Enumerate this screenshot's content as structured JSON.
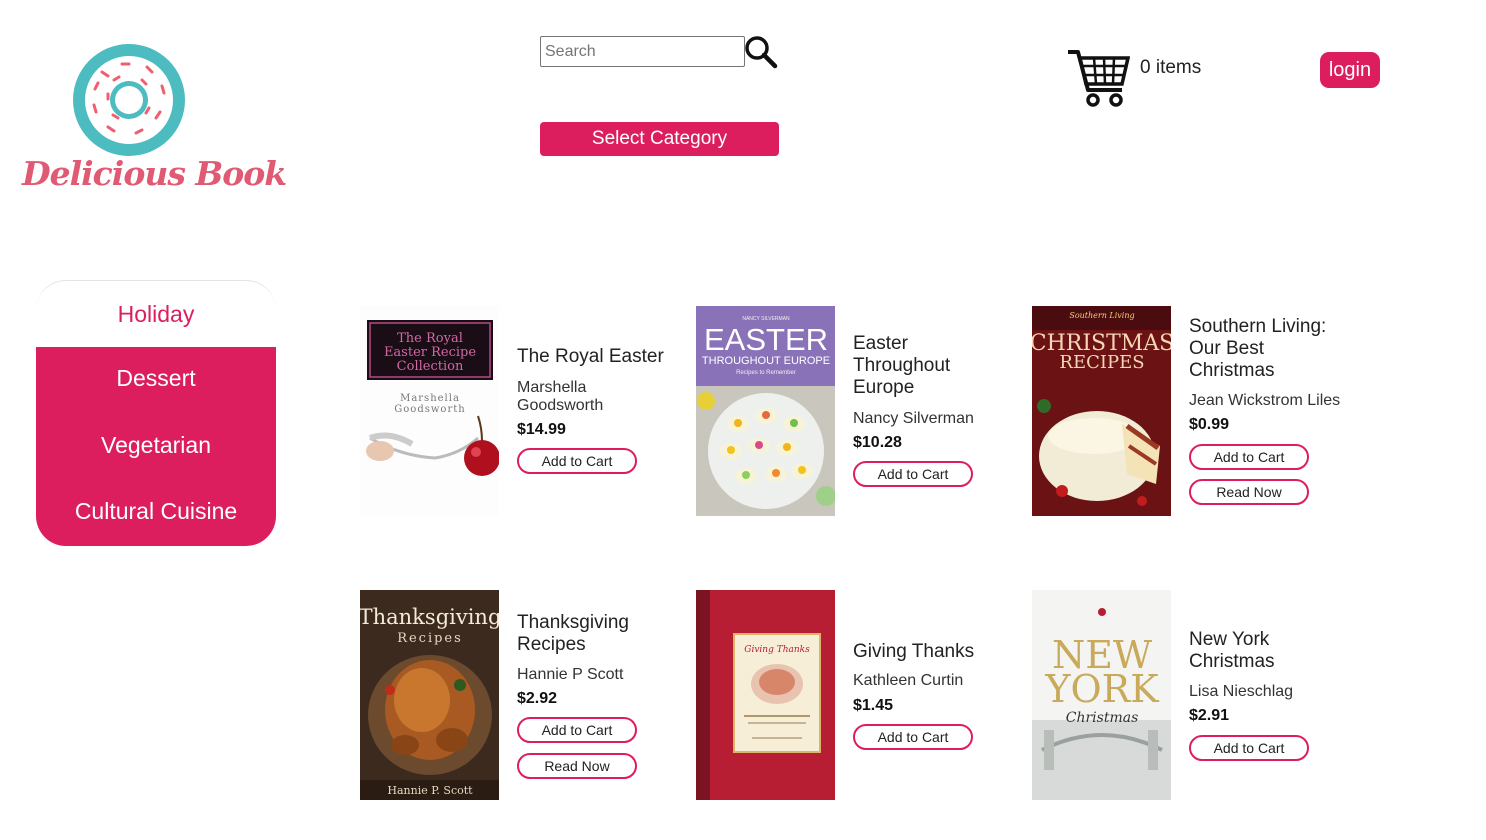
{
  "brand": {
    "name": "Delicious Book",
    "accent": "#dc1e5f",
    "logo_icon": "donut-logo-icon"
  },
  "search": {
    "placeholder": "Search",
    "value": "",
    "icon": "search-icon"
  },
  "category_button": {
    "label": "Select Category"
  },
  "cart": {
    "icon": "cart-icon",
    "count_text": "0 items"
  },
  "login": {
    "label": "login"
  },
  "sidebar": {
    "items": [
      {
        "label": "Holiday",
        "active": true
      },
      {
        "label": "Dessert"
      },
      {
        "label": "Vegetarian"
      },
      {
        "label": "Cultural Cuisine"
      }
    ]
  },
  "products": [
    {
      "title": "The Royal Easter",
      "author": "Marshella Goodsworth",
      "price": "$14.99",
      "add_label": "Add to Cart",
      "cover_text": [
        "The Royal",
        "Easter Recipe",
        "Collection",
        "Marshella",
        "Goodsworth"
      ]
    },
    {
      "title": "Easter Throughout Europe",
      "author": "Nancy Silverman",
      "price": "$10.28",
      "add_label": "Add to Cart",
      "cover_text": [
        "NANCY SILVERMAN",
        "EASTER",
        "THROUGHOUT EUROPE",
        "Recipes to Remember"
      ]
    },
    {
      "title": "Southern Living: Our Best Christmas",
      "author": "Jean Wickstrom Liles",
      "price": "$0.99",
      "add_label": "Add to Cart",
      "read_label": "Read Now",
      "cover_text": [
        "Southern Living",
        "CHRISTMAS",
        "RECIPES"
      ]
    },
    {
      "title": "Thanksgiving Recipes",
      "author": "Hannie P Scott",
      "price": "$2.92",
      "add_label": "Add to Cart",
      "read_label": "Read Now",
      "cover_text": [
        "Thanksgiving",
        "Recipes",
        "Hannie P. Scott"
      ]
    },
    {
      "title": "Giving Thanks",
      "author": "Kathleen Curtin",
      "price": "$1.45",
      "add_label": "Add to Cart",
      "cover_text": [
        "Giving Thanks"
      ]
    },
    {
      "title": "New York Christmas",
      "author": "Lisa Nieschlag",
      "price": "$2.91",
      "add_label": "Add to Cart",
      "cover_text": [
        "NEW",
        "YORK",
        "Christmas"
      ]
    }
  ]
}
